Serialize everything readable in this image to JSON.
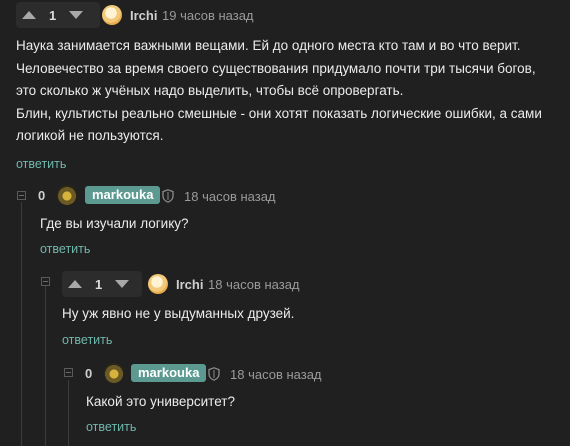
{
  "comments": [
    {
      "rating": "1",
      "author": "Irchi",
      "time": "19 часов назад",
      "text": [
        "Наука занимается важными вещами. Ей до одного места кто там и во что верит.",
        "Человечество за время своего существования придумало почти три тысячи богов,",
        "это сколько ж учёных надо выделить, чтобы всё опровергать.",
        "Блин, культисты реально смешные - они хотят показать логические ошибки, а сами",
        "логикой не пользуются."
      ],
      "reply_label": "ответить"
    },
    {
      "rating": "0",
      "author": "markouka",
      "time": "18 часов назад",
      "text": "Где вы изучали логику?",
      "reply_label": "ответить"
    },
    {
      "rating": "1",
      "author": "Irchi",
      "time": "18 часов назад",
      "text": "Ну уж явно не у выдуманных друзей.",
      "reply_label": "ответить"
    },
    {
      "rating": "0",
      "author": "markouka",
      "time": "18 часов назад",
      "text": "Какой это университет?",
      "reply_label": "ответить"
    }
  ],
  "icons": {
    "upvote": "triangle-up",
    "downvote": "triangle-down",
    "collapse": "minus-square",
    "author_mark": "shield"
  },
  "colors": {
    "background": "#202020",
    "author_badge": "#5c9a91",
    "reply_link": "#6fb7ad",
    "timestamp": "#9a9a9a"
  }
}
